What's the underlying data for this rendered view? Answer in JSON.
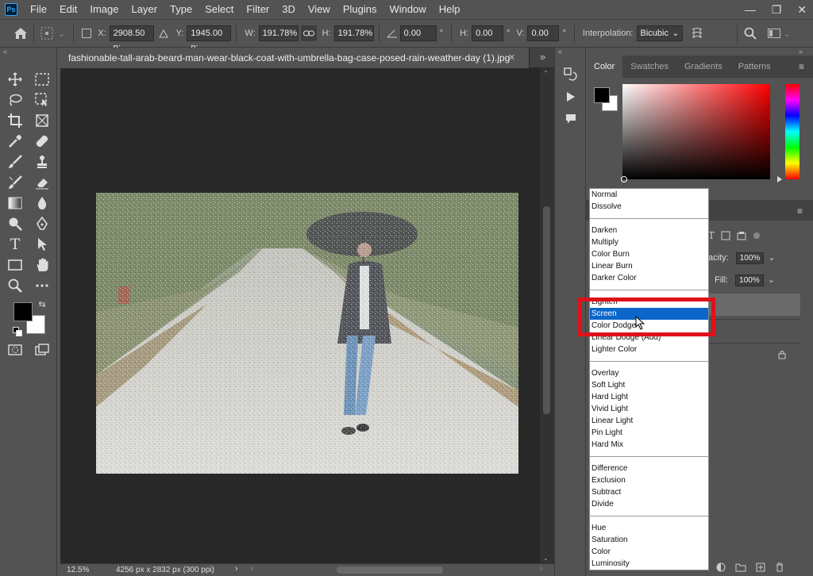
{
  "app": {
    "logo": "Ps"
  },
  "menu": [
    "File",
    "Edit",
    "Image",
    "Layer",
    "Type",
    "Select",
    "Filter",
    "3D",
    "View",
    "Plugins",
    "Window",
    "Help"
  ],
  "window_controls": {
    "minimize": "—",
    "restore": "❐",
    "close": "✕"
  },
  "options": {
    "x_label": "X:",
    "x_value": "2908.50 p:",
    "y_label": "Y:",
    "y_value": "1945.00 p:",
    "w_label": "W:",
    "w_value": "191.78%",
    "h_label": "H:",
    "h_value": "191.78%",
    "angle_value": "0.00",
    "angle_unit": "°",
    "hskew_label": "H:",
    "hskew_value": "0.00",
    "hskew_unit": "°",
    "vskew_label": "V:",
    "vskew_value": "0.00",
    "vskew_unit": "°",
    "interp_label": "Interpolation:",
    "interp_value": "Bicubic"
  },
  "document": {
    "tab_title": "fashionable-tall-arab-beard-man-wear-black-coat-with-umbrella-bag-case-posed-rain-weather-day (1).jpg",
    "zoom": "12.5%",
    "info": "4256 px x 2832 px (300 ppi)"
  },
  "color_panel": {
    "tabs": [
      "Color",
      "Swatches",
      "Gradients",
      "Patterns"
    ],
    "active_tab": "Color",
    "foreground": "#000000",
    "background": "#ffffff"
  },
  "layers": {
    "opacity_label": "acity:",
    "opacity_value": "100%",
    "fill_label": "Fill:",
    "fill_value": "100%"
  },
  "blend_modes": {
    "groups": [
      [
        "Normal",
        "Dissolve"
      ],
      [
        "Darken",
        "Multiply",
        "Color Burn",
        "Linear Burn",
        "Darker Color"
      ],
      [
        "Lighten",
        "Screen",
        "Color Dodge",
        "Linear Dodge (Add)",
        "Lighter Color"
      ],
      [
        "Overlay",
        "Soft Light",
        "Hard Light",
        "Vivid Light",
        "Linear Light",
        "Pin Light",
        "Hard Mix"
      ],
      [
        "Difference",
        "Exclusion",
        "Subtract",
        "Divide"
      ],
      [
        "Hue",
        "Saturation",
        "Color",
        "Luminosity"
      ]
    ],
    "selected": "Screen"
  },
  "colors": {
    "highlight": "#e0101a",
    "selection": "#0b66c9"
  }
}
